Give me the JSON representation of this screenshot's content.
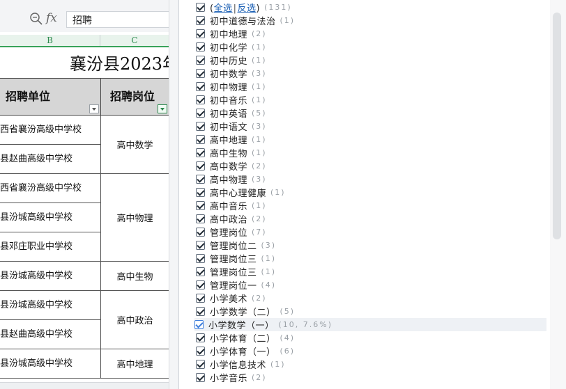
{
  "formula_bar": {
    "zoom_icon": "magnifier-icon",
    "fx_label": "fx",
    "value": "招聘"
  },
  "columns": {
    "b": "B",
    "c": "C"
  },
  "sheet": {
    "title": "襄汾县2023年",
    "header": {
      "unit": "招聘单位",
      "post": "招聘岗位"
    },
    "rows": [
      {
        "unit": "西省襄汾高级中学校"
      },
      {
        "unit": "县赵曲高级中学校"
      },
      {
        "unit": "西省襄汾高级中学校"
      },
      {
        "unit": "县汾城高级中学校"
      },
      {
        "unit": "县邓庄职业中学校"
      },
      {
        "unit": "县汾城高级中学校"
      },
      {
        "unit": "县汾城高级中学校"
      },
      {
        "unit": "县赵曲高级中学校"
      },
      {
        "unit": "县汾城高级中学校"
      }
    ],
    "posts": [
      {
        "label": "高中数学",
        "span": 2
      },
      {
        "label": "高中物理",
        "span": 3
      },
      {
        "label": "高中生物",
        "span": 1
      },
      {
        "label": "高中政治",
        "span": 2
      },
      {
        "label": "高中地理",
        "span": 1
      }
    ]
  },
  "filter": {
    "select_all": {
      "all": "全选",
      "sep": "|",
      "invert": "反选",
      "count": "(131)"
    },
    "items": [
      {
        "label": "初中道德与法治",
        "count": "(1)"
      },
      {
        "label": "初中地理",
        "count": "(2)"
      },
      {
        "label": "初中化学",
        "count": "(1)"
      },
      {
        "label": "初中历史",
        "count": "(1)"
      },
      {
        "label": "初中数学",
        "count": "(3)"
      },
      {
        "label": "初中物理",
        "count": "(1)"
      },
      {
        "label": "初中音乐",
        "count": "(1)"
      },
      {
        "label": "初中英语",
        "count": "(5)"
      },
      {
        "label": "初中语文",
        "count": "(3)"
      },
      {
        "label": "高中地理",
        "count": "(1)"
      },
      {
        "label": "高中生物",
        "count": "(1)"
      },
      {
        "label": "高中数学",
        "count": "(2)"
      },
      {
        "label": "高中物理",
        "count": "(3)"
      },
      {
        "label": "高中心理健康",
        "count": "(1)"
      },
      {
        "label": "高中音乐",
        "count": "(1)"
      },
      {
        "label": "高中政治",
        "count": "(2)"
      },
      {
        "label": "管理岗位",
        "count": "(7)"
      },
      {
        "label": "管理岗位二",
        "count": "(3)"
      },
      {
        "label": "管理岗位三",
        "count": "(1)"
      },
      {
        "label": "管理岗位三",
        "count": "(1)"
      },
      {
        "label": "管理岗位一",
        "count": "(4)"
      },
      {
        "label": "小学美术",
        "count": "(2)"
      },
      {
        "label": "小学数学（二）",
        "count": "(5)"
      },
      {
        "label": "小学数学（一）",
        "count": "(10, 7.6%)"
      },
      {
        "label": "小学体育（二）",
        "count": "(4)"
      },
      {
        "label": "小学体育（一）",
        "count": "(6)"
      },
      {
        "label": "小学信息技术",
        "count": "(1)"
      },
      {
        "label": "小学音乐",
        "count": "(2)"
      }
    ]
  }
}
